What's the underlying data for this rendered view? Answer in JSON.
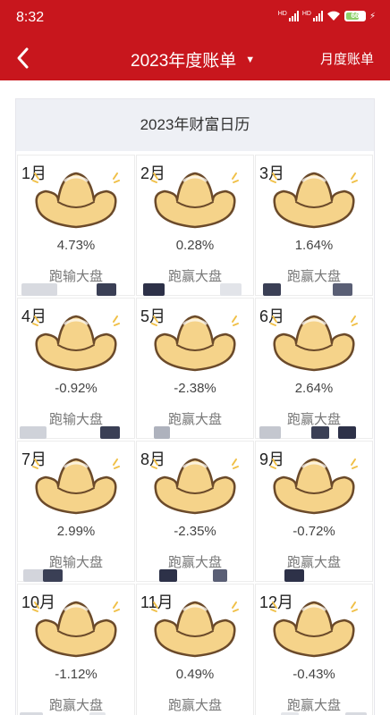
{
  "status": {
    "time": "8:32",
    "battery": "66"
  },
  "navbar": {
    "title": "2023年度账单",
    "right_label": "月度账单"
  },
  "calendar": {
    "title": "2023年财富日历",
    "months": [
      {
        "label": "1月",
        "pct": "4.73%",
        "result": "跑输大盘"
      },
      {
        "label": "2月",
        "pct": "0.28%",
        "result": "跑赢大盘"
      },
      {
        "label": "3月",
        "pct": "1.64%",
        "result": "跑赢大盘"
      },
      {
        "label": "4月",
        "pct": "-0.92%",
        "result": "跑输大盘"
      },
      {
        "label": "5月",
        "pct": "-2.38%",
        "result": "跑赢大盘"
      },
      {
        "label": "6月",
        "pct": "2.64%",
        "result": "跑赢大盘"
      },
      {
        "label": "7月",
        "pct": "2.99%",
        "result": "跑输大盘"
      },
      {
        "label": "8月",
        "pct": "-2.35%",
        "result": "跑赢大盘"
      },
      {
        "label": "9月",
        "pct": "-0.72%",
        "result": "跑赢大盘"
      },
      {
        "label": "10月",
        "pct": "-1.12%",
        "result": "跑赢大盘"
      },
      {
        "label": "11月",
        "pct": "0.49%",
        "result": "跑赢大盘"
      },
      {
        "label": "12月",
        "pct": "-0.43%",
        "result": "跑赢大盘"
      }
    ]
  },
  "colors": {
    "brand_red": "#c8161d",
    "ingot_gold": "#f5d38a",
    "ingot_outline": "#6b4a2a"
  }
}
